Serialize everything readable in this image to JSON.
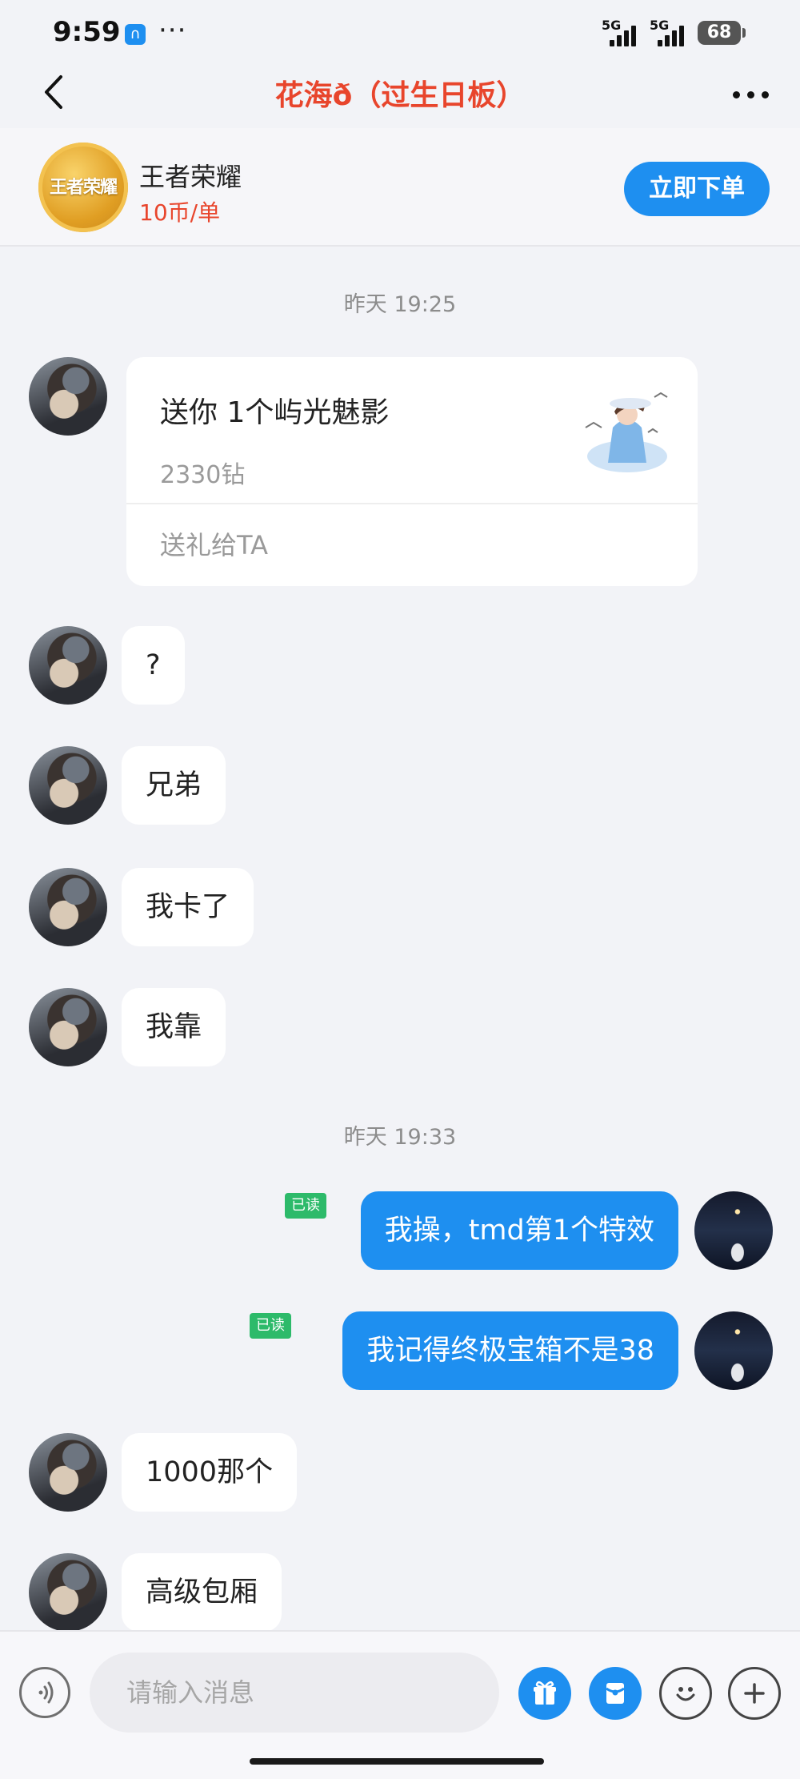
{
  "status_bar": {
    "time": "9:59",
    "app_badge": "∩",
    "more": "···",
    "network1": "5G",
    "network2": "5G",
    "battery": "68"
  },
  "header": {
    "title": "花海ð（过生日板）"
  },
  "service": {
    "game_name": "王者荣耀",
    "price": "10币/单",
    "logo_text": "王者荣耀",
    "order_button": "立即下单"
  },
  "chat": {
    "timestamp1": "昨天 19:25",
    "gift": {
      "title": "送你 1个屿光魅影",
      "price": "2330钻",
      "action": "送礼给TA"
    },
    "messages_a": [
      {
        "text": "?"
      },
      {
        "text": "兄弟"
      },
      {
        "text": "我卡了"
      },
      {
        "text": "我靠"
      }
    ],
    "timestamp2": "昨天 19:33",
    "messages_self": [
      {
        "text": "我操，tmd第1个特效",
        "status": "已读"
      },
      {
        "text": "我记得终极宝箱不是38",
        "status": "已读"
      }
    ],
    "messages_b": [
      {
        "text": "1000那个"
      },
      {
        "text": "高级包厢"
      }
    ]
  },
  "input": {
    "placeholder": "请输入消息"
  },
  "colors": {
    "accent_blue": "#1e8ff0",
    "title_red": "#e8452c",
    "read_green": "#2dba6a",
    "background": "#f2f3f7"
  },
  "icons": [
    "back-arrow-icon",
    "more-dots-icon",
    "voice-icon",
    "gift-icon",
    "red-packet-icon",
    "emoji-icon",
    "plus-icon"
  ]
}
